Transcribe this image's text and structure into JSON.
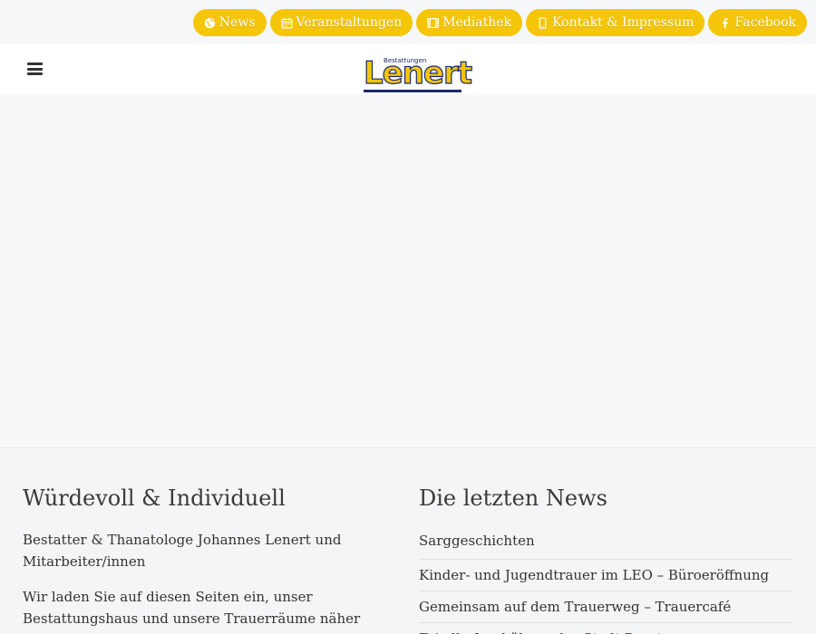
{
  "topnav": {
    "items": [
      {
        "label": "News",
        "icon": "globe-icon"
      },
      {
        "label": "Veranstaltungen",
        "icon": "calendar-icon"
      },
      {
        "label": "Mediathek",
        "icon": "film-icon"
      },
      {
        "label": "Kontakt & Impressum",
        "icon": "phone-icon"
      },
      {
        "label": "Facebook",
        "icon": "facebook-icon"
      }
    ],
    "accent": "#f5c50a"
  },
  "header": {
    "logo_small": "Bestattungen",
    "logo_big": "Lenert"
  },
  "about": {
    "title": "Würdevoll & Individuell",
    "paragraphs": [
      "Bestatter & Thanatologe Johannes Lenert und Mitarbeiter/innen",
      "Wir laden Sie auf diesen Seiten ein, unser Bestattungshaus und unsere Trauerräume näher kennen"
    ]
  },
  "news": {
    "title": "Die letzten News",
    "items": [
      "Sarggeschichten",
      "Kinder- und Jugendtrauer im LEO – Büroeröffnung",
      "Gemeinsam auf dem Trauerweg – Trauercafé",
      "Friedhofsgebühren der Stadt Dorsten"
    ]
  }
}
